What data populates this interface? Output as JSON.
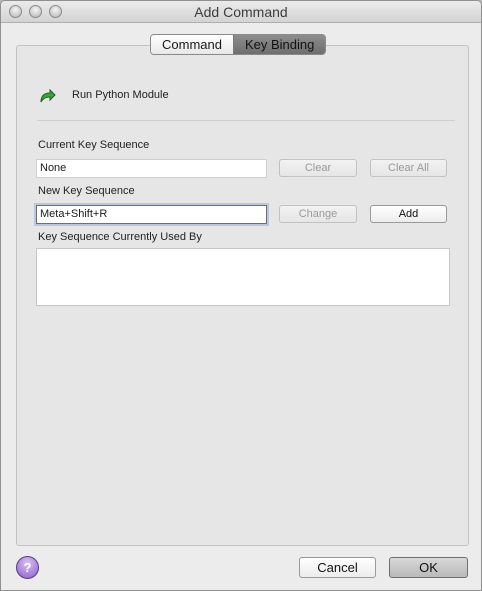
{
  "window": {
    "title": "Add Command"
  },
  "tabs": [
    {
      "label": "Command",
      "selected": false
    },
    {
      "label": "Key Binding",
      "selected": true
    }
  ],
  "command": {
    "icon": "green-arrow-icon",
    "name": "Run Python Module"
  },
  "current_key": {
    "label": "Current Key Sequence",
    "value": "None",
    "clear_label": "Clear",
    "clear_all_label": "Clear All"
  },
  "new_key": {
    "label": "New Key Sequence",
    "value": "Meta+Shift+R",
    "change_label": "Change",
    "add_label": "Add"
  },
  "used_by": {
    "label": "Key Sequence Currently Used By",
    "items": []
  },
  "footer": {
    "help_glyph": "?",
    "cancel_label": "Cancel",
    "ok_label": "OK"
  },
  "colors": {
    "help_button": "#8b5cc9",
    "run_icon": "#2e8b2e"
  }
}
